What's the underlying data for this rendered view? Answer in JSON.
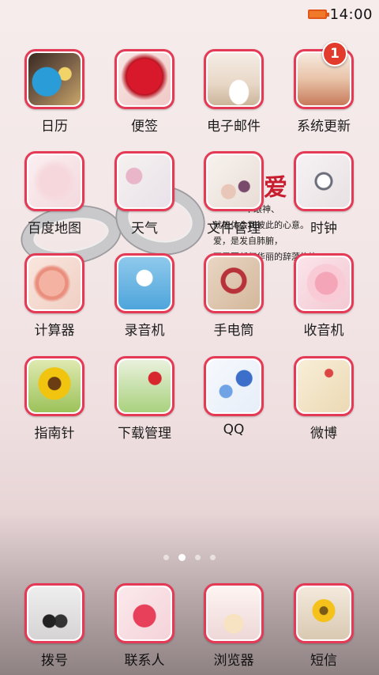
{
  "status_bar": {
    "time": "14:00",
    "battery_icon": "battery-icon"
  },
  "wallpaper": {
    "poem_title": "爱",
    "poem_lines": [
      "个眼神、",
      "就能体会到彼此的心意。",
      "爱，是发自肺腑，",
      "不需要任何华丽的辞藻修饰"
    ]
  },
  "apps": [
    {
      "label": "日历",
      "icon": "calendar-icon"
    },
    {
      "label": "便签",
      "icon": "notes-icon"
    },
    {
      "label": "电子邮件",
      "icon": "email-icon"
    },
    {
      "label": "系统更新",
      "icon": "system-update-icon",
      "badge": "1"
    },
    {
      "label": "百度地图",
      "icon": "map-icon"
    },
    {
      "label": "天气",
      "icon": "weather-icon"
    },
    {
      "label": "文件管理",
      "icon": "file-manager-icon"
    },
    {
      "label": "时钟",
      "icon": "clock-icon"
    },
    {
      "label": "计算器",
      "icon": "calculator-icon"
    },
    {
      "label": "录音机",
      "icon": "recorder-icon"
    },
    {
      "label": "手电筒",
      "icon": "flashlight-icon"
    },
    {
      "label": "收音机",
      "icon": "radio-icon"
    },
    {
      "label": "指南针",
      "icon": "compass-icon"
    },
    {
      "label": "下载管理",
      "icon": "download-manager-icon"
    },
    {
      "label": "QQ",
      "icon": "qq-icon"
    },
    {
      "label": "微博",
      "icon": "weibo-icon"
    }
  ],
  "pager": {
    "count": 4,
    "active_index": 1
  },
  "dock": [
    {
      "label": "拨号",
      "icon": "dialer-icon"
    },
    {
      "label": "联系人",
      "icon": "contacts-icon"
    },
    {
      "label": "浏览器",
      "icon": "browser-icon"
    },
    {
      "label": "短信",
      "icon": "messaging-icon"
    }
  ],
  "accent_color": "#e53a55"
}
